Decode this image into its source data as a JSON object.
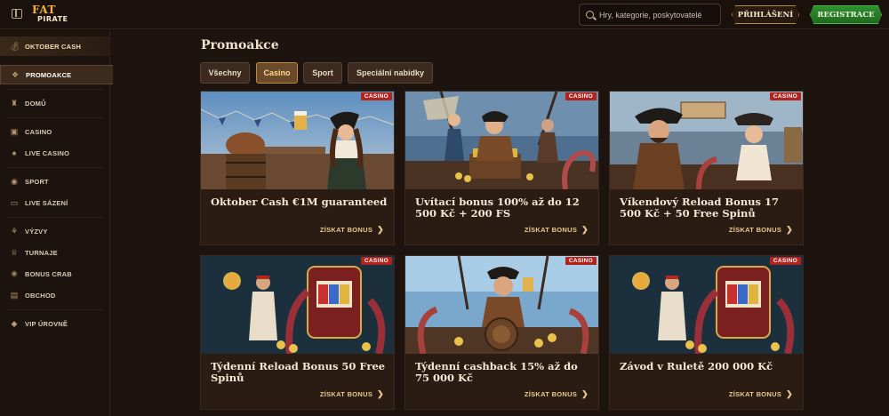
{
  "header": {
    "logo_top": "FAT",
    "logo_bottom": "PIRATE",
    "search_placeholder": "Hry, kategorie, poskytovatelé",
    "login_label": "PŘIHLÁŠENÍ",
    "register_label": "REGISTRACE"
  },
  "sidebar": {
    "items": [
      {
        "label": "OKTOBER CASH",
        "icon": "money-bag-icon"
      },
      {
        "label": "PROMOAKCE",
        "icon": "gift-icon"
      },
      {
        "label": "DOMŮ",
        "icon": "castle-icon"
      },
      {
        "label": "CASINO",
        "icon": "slot-machine-icon"
      },
      {
        "label": "LIVE CASINO",
        "icon": "cards-icon"
      },
      {
        "label": "SPORT",
        "icon": "soccer-ball-icon"
      },
      {
        "label": "LIVE SÁZENÍ",
        "icon": "live-tv-icon"
      },
      {
        "label": "VÝZVY",
        "icon": "medal-icon"
      },
      {
        "label": "TURNAJE",
        "icon": "trophy-icon"
      },
      {
        "label": "BONUS CRAB",
        "icon": "crab-icon"
      },
      {
        "label": "OBCHOD",
        "icon": "shop-basket-icon"
      },
      {
        "label": "VIP ÚROVNĚ",
        "icon": "diamond-icon"
      }
    ]
  },
  "main": {
    "title": "Promoakce",
    "tabs": [
      {
        "label": "Všechny"
      },
      {
        "label": "Casino"
      },
      {
        "label": "Sport"
      },
      {
        "label": "Speciální nabídky"
      }
    ],
    "active_tab": "Casino",
    "cards": [
      {
        "badge": "CASINO",
        "title": "Oktober Cash €1M guaranteed",
        "cta": "ZÍSKAT BONUS"
      },
      {
        "badge": "CASINO",
        "title": "Uvítací bonus 100% až do 12 500 Kč + 200 FS",
        "cta": "ZÍSKAT BONUS"
      },
      {
        "badge": "CASINO",
        "title": "Víkendový Reload Bonus 17 500 Kč + 50 Free Spinů",
        "cta": "ZÍSKAT BONUS"
      },
      {
        "badge": "CASINO",
        "title": "Týdenní Reload Bonus 50 Free Spinů",
        "cta": "ZÍSKAT BONUS"
      },
      {
        "badge": "CASINO",
        "title": "Týdenní cashback 15% až do 75 000 Kč",
        "cta": "ZÍSKAT BONUS"
      },
      {
        "badge": "CASINO",
        "title": "Závod v Ruletě 200 000 Kč",
        "cta": "ZÍSKAT BONUS"
      }
    ]
  },
  "colors": {
    "accent_gold": "#e9c98e",
    "badge_red": "#b3231e",
    "register_green": "#2f8f2f",
    "background": "#1e140f"
  }
}
